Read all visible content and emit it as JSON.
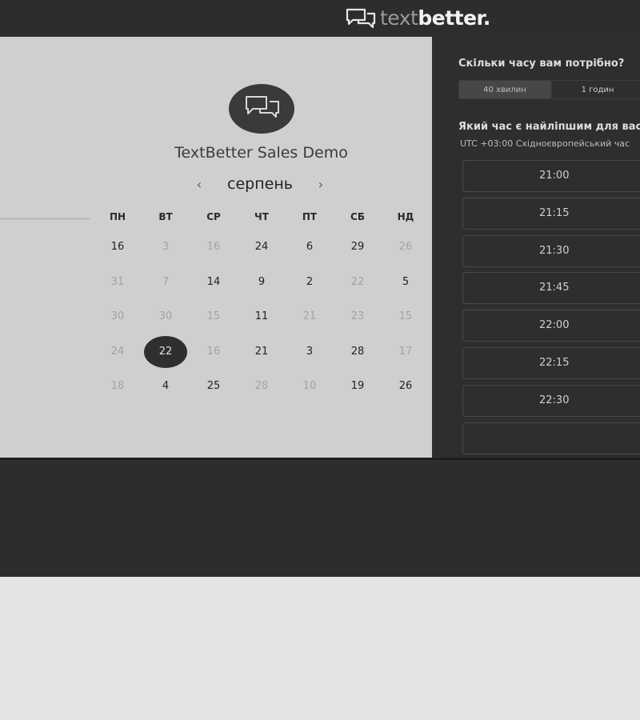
{
  "brand": {
    "text_light": "text",
    "text_bold": "better.",
    "logo_icon": "chat-bubbles-icon"
  },
  "event": {
    "title": "TextBetter Sales Demo",
    "avatar_icon": "chat-bubbles-icon"
  },
  "calendar": {
    "month": "серпень",
    "prev_icon": "chevron-left-icon",
    "next_icon": "chevron-right-icon",
    "weekdays": [
      "ПН",
      "ВТ",
      "СР",
      "ЧТ",
      "ПТ",
      "СБ",
      "НД"
    ],
    "weeks": [
      [
        {
          "d": "16",
          "muted": false
        },
        {
          "d": "3",
          "muted": true
        },
        {
          "d": "16",
          "muted": true
        },
        {
          "d": "24",
          "muted": false
        },
        {
          "d": "6",
          "muted": false
        },
        {
          "d": "29",
          "muted": false
        },
        {
          "d": "26",
          "muted": true
        }
      ],
      [
        {
          "d": "31",
          "muted": true
        },
        {
          "d": "7",
          "muted": true
        },
        {
          "d": "14",
          "muted": false
        },
        {
          "d": "9",
          "muted": false
        },
        {
          "d": "2",
          "muted": false
        },
        {
          "d": "22",
          "muted": true
        },
        {
          "d": "5",
          "muted": false
        }
      ],
      [
        {
          "d": "30",
          "muted": true
        },
        {
          "d": "30",
          "muted": true
        },
        {
          "d": "15",
          "muted": true
        },
        {
          "d": "11",
          "muted": false
        },
        {
          "d": "21",
          "muted": true
        },
        {
          "d": "23",
          "muted": true
        },
        {
          "d": "15",
          "muted": true
        }
      ],
      [
        {
          "d": "24",
          "muted": true
        },
        {
          "d": "22",
          "muted": false,
          "selected": true
        },
        {
          "d": "16",
          "muted": true
        },
        {
          "d": "21",
          "muted": false
        },
        {
          "d": "3",
          "muted": false
        },
        {
          "d": "28",
          "muted": false
        },
        {
          "d": "17",
          "muted": true
        }
      ],
      [
        {
          "d": "18",
          "muted": true
        },
        {
          "d": "4",
          "muted": false
        },
        {
          "d": "25",
          "muted": false
        },
        {
          "d": "28",
          "muted": true
        },
        {
          "d": "10",
          "muted": true
        },
        {
          "d": "19",
          "muted": false
        },
        {
          "d": "26",
          "muted": false
        }
      ]
    ]
  },
  "booking": {
    "duration_question": "Скільки часу вам потрібно?",
    "durations": [
      {
        "label": "40 хвилин",
        "active": true
      },
      {
        "label": "1 годин",
        "active": false
      }
    ],
    "time_question": "Який час є найліпшим для вас?",
    "timezone": "UTC +03:00 Східноєвропейський час",
    "slots": [
      "21:00",
      "21:15",
      "21:30",
      "21:45",
      "22:00",
      "22:15",
      "22:30",
      ""
    ]
  },
  "colors": {
    "topbar": "#2d2d2d",
    "panel_light": "#cfcfcf",
    "panel_dark": "#2e2e2e",
    "selected_day": "#2f2f2f"
  }
}
